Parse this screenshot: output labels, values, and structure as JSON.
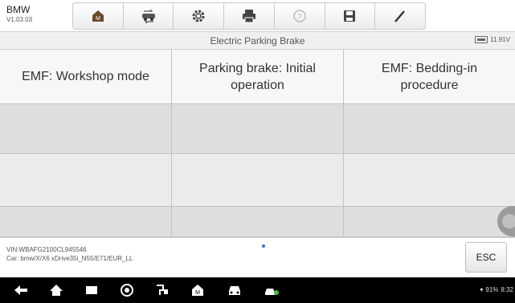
{
  "header": {
    "brand": "BMW",
    "version": "V1.03.03",
    "toolbar": [
      {
        "icon": "home-icon"
      },
      {
        "icon": "vehicle-swap-icon"
      },
      {
        "icon": "settings-gear-icon"
      },
      {
        "icon": "print-icon"
      },
      {
        "icon": "help-icon"
      },
      {
        "icon": "save-icon"
      },
      {
        "icon": "pen-icon"
      }
    ]
  },
  "subheader": {
    "title": "Electric Parking Brake",
    "voltage": "11.91V"
  },
  "menu": {
    "items": [
      {
        "label": "EMF: Workshop mode"
      },
      {
        "label": "Parking brake: Initial operation"
      },
      {
        "label": "EMF: Bedding-in procedure"
      }
    ]
  },
  "footer": {
    "vin": "VIN:WBAFG2100CL945546",
    "car": "Car: bmw/X/X6 xDrive35i_N55/E71/EUR_LL",
    "esc_label": "ESC"
  },
  "navbar": {
    "status_text": "91%",
    "time": "8:32"
  },
  "colors": {
    "accent": "#3a6fd0",
    "navbar_bg": "#000000",
    "cell_light": "#f7f7f7",
    "cell_dark": "#dedede"
  }
}
